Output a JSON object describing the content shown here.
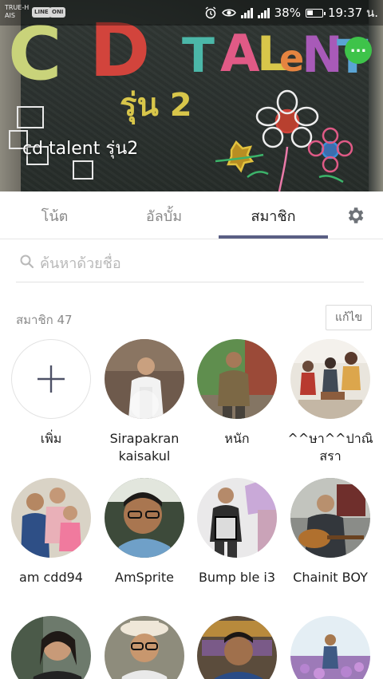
{
  "status_bar": {
    "carrier_line1": "TRUE-H",
    "carrier_line2": "AIS",
    "pill_line": "LINE",
    "pill_oni": "ONI",
    "battery": "38%",
    "time": "19:37 น."
  },
  "cover": {
    "chalk_text": [
      "C",
      "D",
      "T",
      "A",
      "L",
      "e",
      "N",
      "T"
    ],
    "chalk_sub": "รุ่น 2",
    "group_name": "cd talent รุ่น2"
  },
  "tabs": [
    {
      "label": "โน้ต",
      "active": false
    },
    {
      "label": "อัลบั้ม",
      "active": false
    },
    {
      "label": "สมาชิก",
      "active": true
    }
  ],
  "search": {
    "placeholder": "ค้นหาด้วยชื่อ"
  },
  "members_header": {
    "count_label": "สมาชิก 47",
    "edit_label": "แก้ไข"
  },
  "add_member_label": "เพิ่ม",
  "members": [
    {
      "name": "Sirapakran kaisakul"
    },
    {
      "name": "หนัก"
    },
    {
      "name": "^^ษา^^ปาณิ สรา"
    },
    {
      "name": "am cdd94"
    },
    {
      "name": "AmSprite"
    },
    {
      "name": "Bump ble i3"
    },
    {
      "name": "Chainit BOY"
    },
    {
      "name": ""
    },
    {
      "name": ""
    },
    {
      "name": ""
    },
    {
      "name": ""
    }
  ],
  "colors": {
    "accent": "#5a5f84",
    "chat_green": "#3ec34a"
  }
}
